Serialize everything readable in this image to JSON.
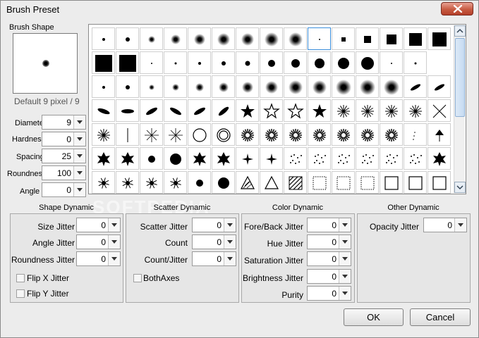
{
  "window": {
    "title": "Brush Preset"
  },
  "brush_shape": {
    "label": "Brush Shape",
    "caption": "Default 9 pixel / 9",
    "fields": [
      {
        "label": "Diameter",
        "value": "9"
      },
      {
        "label": "Hardness",
        "value": "0"
      },
      {
        "label": "Spacing",
        "value": "25"
      },
      {
        "label": "Roundness",
        "value": "100"
      },
      {
        "label": "Angle",
        "value": "0"
      }
    ]
  },
  "presets": {
    "rows": [
      [
        "dot",
        "dot",
        "soft",
        "soft",
        "soft",
        "soft",
        "soft",
        "soft",
        "soft",
        "dot",
        "square",
        "square",
        "square",
        "square",
        "square"
      ],
      [
        "square",
        "square",
        "dot",
        "dot",
        "dot",
        "dot",
        "dot",
        "circle",
        "circle",
        "circle",
        "circle",
        "circle",
        "dot",
        "dot"
      ],
      [
        "dot",
        "dot",
        "soft",
        "soft",
        "soft",
        "soft",
        "soft",
        "soft",
        "soft",
        "soft",
        "soft",
        "soft",
        "soft",
        "stroke",
        "stroke"
      ],
      [
        "ellipse",
        "ellipse",
        "ellipse",
        "ellipse",
        "ellipse",
        "ellipse",
        "star",
        "star-outline",
        "star-outline",
        "star",
        "burst",
        "burst",
        "burst",
        "burst",
        "cross"
      ],
      [
        "burst",
        "line",
        "hash",
        "hash",
        "ring",
        "double-ring",
        "sun",
        "sun",
        "sun",
        "sun",
        "sun",
        "sun",
        "sun",
        "sparse",
        "tree"
      ],
      [
        "leaf",
        "leaf",
        "blob",
        "blob",
        "leaf",
        "leaf",
        "sparkle",
        "sparkle",
        "dots",
        "dots",
        "dots",
        "dots",
        "dots",
        "dots",
        "leaf"
      ],
      [
        "splat",
        "splat",
        "splat",
        "splat",
        "blob",
        "blob",
        "triangle-hatch",
        "triangle-outline",
        "hatch-square",
        "dotted-square",
        "dotted-square",
        "dotted-square",
        "square-outline",
        "square-outline",
        "square-outline"
      ]
    ],
    "selected_cell": "row0-col9"
  },
  "watermark": "SOFTPEDIA",
  "shape_dynamic": {
    "title": "Shape Dynamic",
    "fields": [
      {
        "label": "Size Jitter",
        "value": "0"
      },
      {
        "label": "Angle Jitter",
        "value": "0"
      },
      {
        "label": "Roundness Jitter",
        "value": "0"
      }
    ],
    "checkboxes": [
      "Flip X Jitter",
      "Flip Y Jitter"
    ]
  },
  "scatter_dynamic": {
    "title": "Scatter Dynamic",
    "fields": [
      {
        "label": "Scatter Jitter",
        "value": "0"
      },
      {
        "label": "Count",
        "value": "0"
      },
      {
        "label": "Count/Jitter",
        "value": "0"
      }
    ],
    "checkboxes": [
      "BothAxes"
    ]
  },
  "color_dynamic": {
    "title": "Color Dynamic",
    "fields": [
      {
        "label": "Fore/Back Jitter",
        "value": "0"
      },
      {
        "label": "Hue Jitter",
        "value": "0"
      },
      {
        "label": "Saturation Jitter",
        "value": "0"
      },
      {
        "label": "Brightness Jitter",
        "value": "0"
      },
      {
        "label": "Purity",
        "value": "0"
      }
    ]
  },
  "other_dynamic": {
    "title": "Other Dynamic",
    "fields": [
      {
        "label": "Opacity Jitter",
        "value": "0"
      }
    ]
  },
  "buttons": {
    "ok": "OK",
    "cancel": "Cancel"
  }
}
